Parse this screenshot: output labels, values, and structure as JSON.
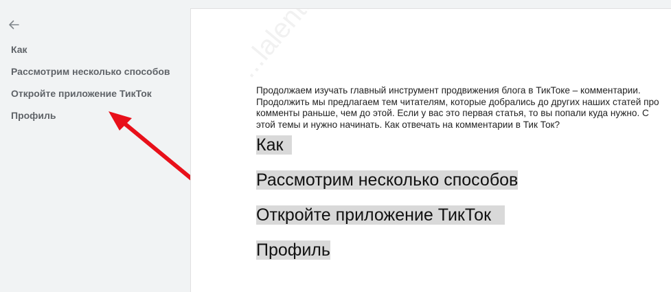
{
  "sidebar": {
    "back_icon": "arrow-left-icon",
    "items": [
      {
        "label": "Как"
      },
      {
        "label": "Рассмотрим несколько способов"
      },
      {
        "label": "Откройте приложение ТикТок"
      },
      {
        "label": "Профиль"
      }
    ]
  },
  "document": {
    "intro": "Продолжаем изучать главный инструмент продвижения блога в ТикТоке – комментарии. Продолжить мы предлагаем тем читателям, которые добрались до других наших статей про комменты раньше, чем до этой. Если у вас это первая статья, то вы попали куда нужно. С этой темы и нужно начинать. Как отвечать на комментарии в Тик Ток?",
    "headings": [
      {
        "text": "Как"
      },
      {
        "text": "Рассмотрим несколько способов"
      },
      {
        "text": "Откройте приложение ТикТок"
      },
      {
        "text": "Профиль"
      }
    ],
    "watermark": "...lalenta.ru"
  },
  "colors": {
    "sidebar_bg": "#f1f3f4",
    "outline_text": "#5f6368",
    "heading_highlight": "#d9d9d9",
    "arrow": "#e8101a"
  }
}
